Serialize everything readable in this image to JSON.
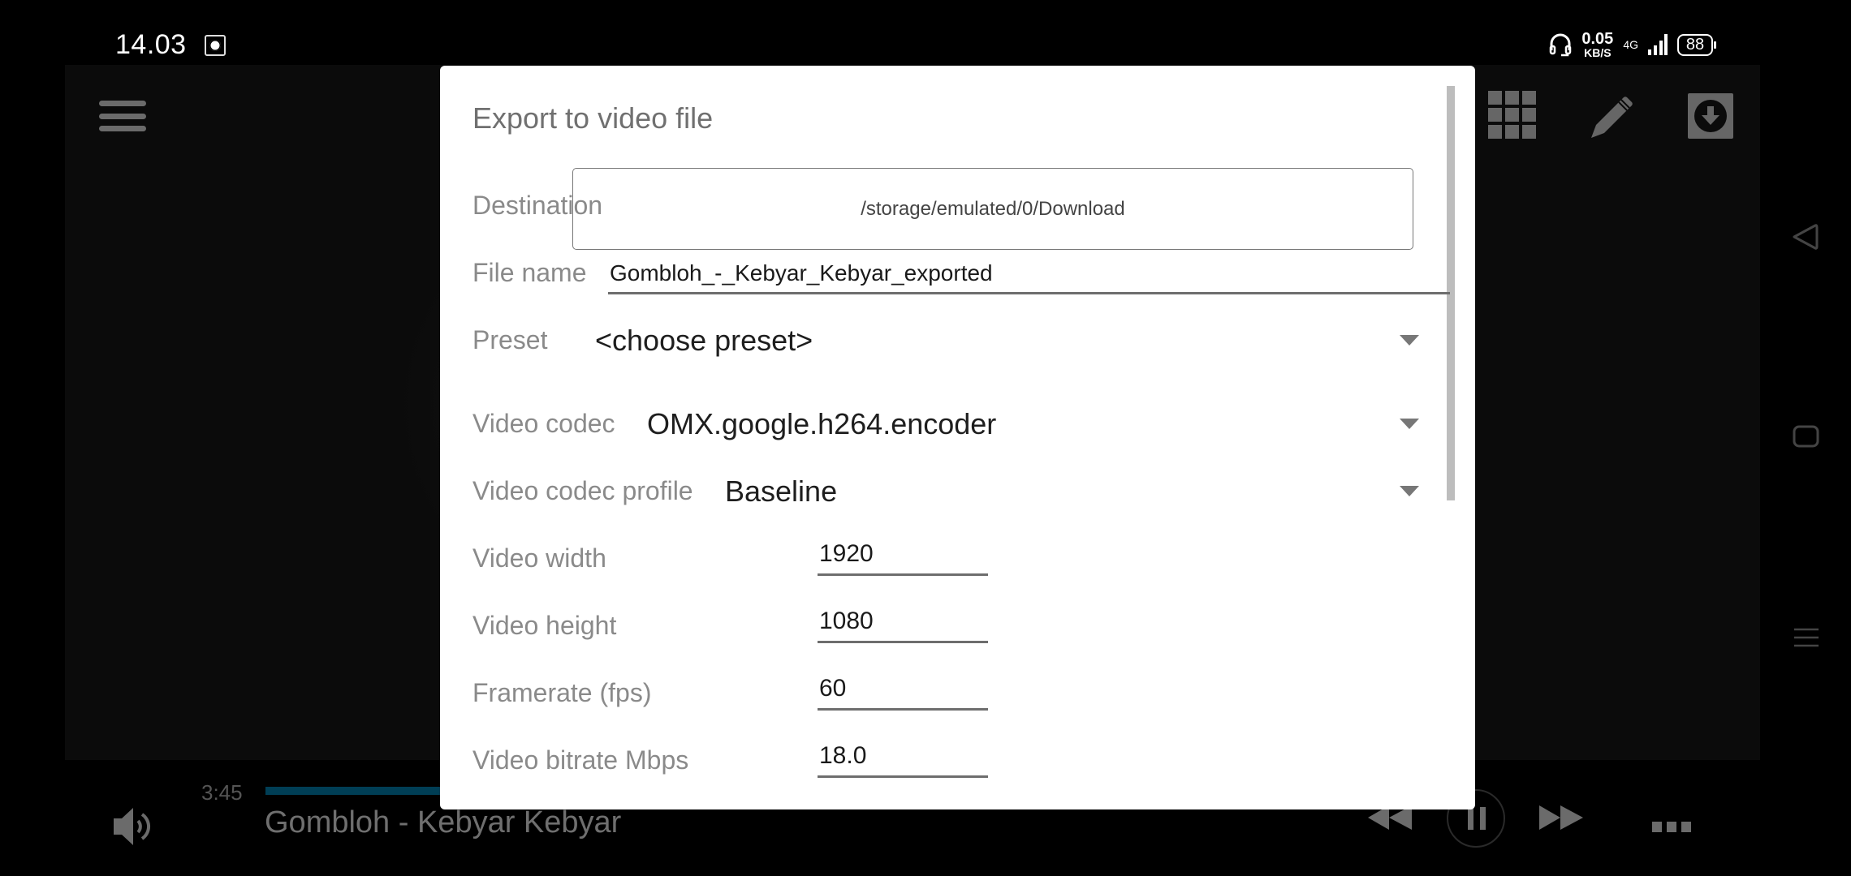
{
  "status_bar": {
    "time": "14.03",
    "net_speed_value": "0.05",
    "net_speed_unit": "KB/S",
    "network_type": "4G",
    "battery": "88"
  },
  "app": {
    "toolbar_icons": [
      "menu-icon",
      "grid-icon",
      "pencil-icon",
      "download-icon"
    ]
  },
  "dialog": {
    "title": "Export to video file",
    "destination": {
      "label": "Destination",
      "value": "/storage/emulated/0/Download"
    },
    "file_name": {
      "label": "File name",
      "value": "Gombloh_-_Kebyar_Kebyar_exported"
    },
    "preset": {
      "label": "Preset",
      "value": "<choose preset>"
    },
    "video_codec": {
      "label": "Video codec",
      "value": "OMX.google.h264.encoder"
    },
    "video_codec_profile": {
      "label": "Video codec profile",
      "value": "Baseline"
    },
    "video_width": {
      "label": "Video width",
      "value": "1920"
    },
    "video_height": {
      "label": "Video height",
      "value": "1080"
    },
    "framerate": {
      "label": "Framerate (fps)",
      "value": "60"
    },
    "video_bitrate": {
      "label": "Video bitrate Mbps",
      "value": "18.0"
    }
  },
  "player": {
    "elapsed": "3:45",
    "track_title": "Gombloh - Kebyar Kebyar",
    "accent_color": "#003e55"
  },
  "navbar": {
    "buttons": [
      "back-icon",
      "home-icon",
      "recents-icon"
    ]
  }
}
